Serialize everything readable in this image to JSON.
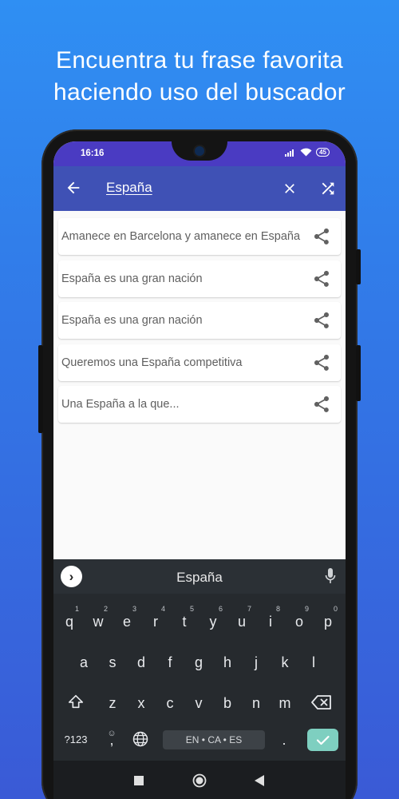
{
  "headline": {
    "line1": "Encuentra tu frase favorita",
    "line2": "haciendo uso del buscador"
  },
  "status_bar": {
    "time": "16:16",
    "battery": "45"
  },
  "app_bar": {
    "search_query": "España",
    "icons": [
      "arrow-back-icon",
      "close-icon",
      "shuffle-icon"
    ]
  },
  "results": [
    {
      "text": "Amanece en Barcelona y amanece en España"
    },
    {
      "text": "España es una gran nación"
    },
    {
      "text": "España es una gran nación"
    },
    {
      "text": "Queremos una España competitiva"
    },
    {
      "text": "Una España a la que..."
    }
  ],
  "keyboard": {
    "suggestion": "España",
    "row1": [
      {
        "k": "q",
        "s": "1"
      },
      {
        "k": "w",
        "s": "2"
      },
      {
        "k": "e",
        "s": "3"
      },
      {
        "k": "r",
        "s": "4"
      },
      {
        "k": "t",
        "s": "5"
      },
      {
        "k": "y",
        "s": "6"
      },
      {
        "k": "u",
        "s": "7"
      },
      {
        "k": "i",
        "s": "8"
      },
      {
        "k": "o",
        "s": "9"
      },
      {
        "k": "p",
        "s": "0"
      }
    ],
    "row2": [
      "a",
      "s",
      "d",
      "f",
      "g",
      "h",
      "j",
      "k",
      "l"
    ],
    "row3": [
      "z",
      "x",
      "c",
      "v",
      "b",
      "n",
      "m"
    ],
    "symbols_label": "?123",
    "comma": ",",
    "period": ".",
    "space_label": "EN • CA • ES"
  },
  "colors": {
    "app_bar": "#3f51b5",
    "status_bar": "#4a3bc2",
    "enter_key": "#7ecfc0"
  }
}
